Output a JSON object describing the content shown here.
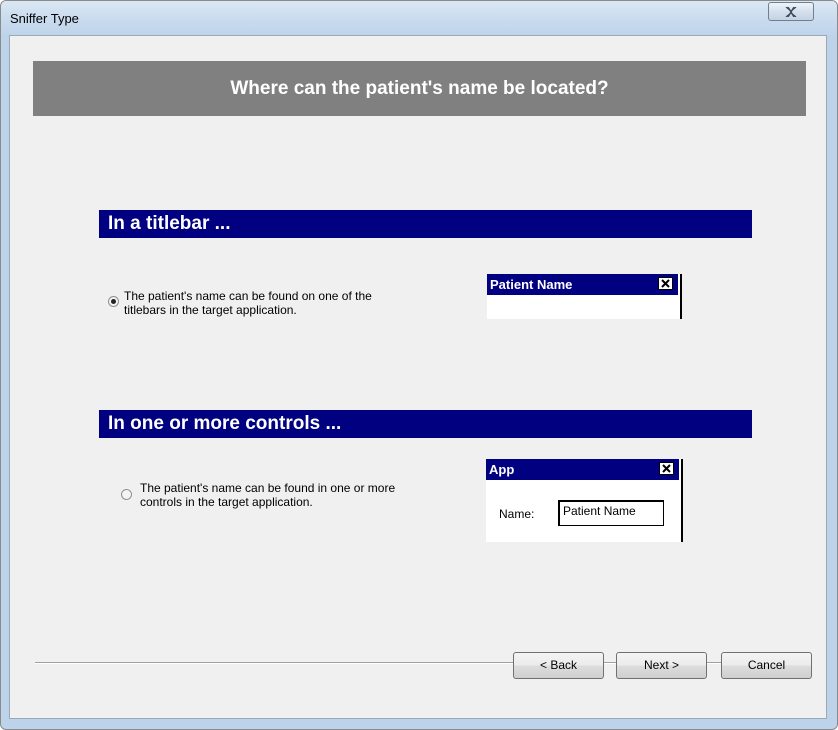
{
  "window": {
    "title": "Sniffer Type"
  },
  "header": {
    "question": "Where can the patient's name be located?"
  },
  "sections": {
    "titlebar": {
      "heading": "In a titlebar ...",
      "option_line1": "The patient's name can be found on one of the",
      "option_line2": "titlebars in the target application.",
      "selected": true,
      "preview_title": "Patient Name"
    },
    "controls": {
      "heading": "In one or more controls ...",
      "option_line1": "The patient's name can be found in one or more",
      "option_line2": "controls in the target application.",
      "selected": false,
      "preview_title": "App",
      "preview_field_label": "Name:",
      "preview_field_value": "Patient Name"
    }
  },
  "buttons": {
    "back": "< Back",
    "next": "Next >",
    "cancel": "Cancel"
  },
  "icons": {
    "close": "close-icon",
    "preview_close": "close-icon"
  },
  "colors": {
    "header_band": "#808080",
    "section_bar": "#000080",
    "window_frame": "#bdd3ea"
  }
}
